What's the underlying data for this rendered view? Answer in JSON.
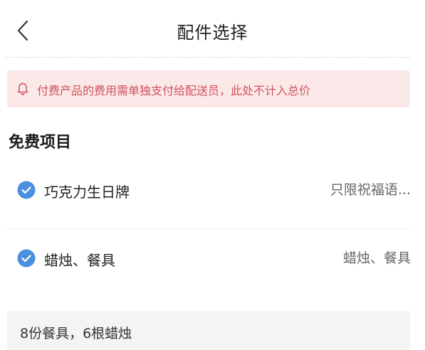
{
  "header": {
    "title": "配件选择",
    "back_icon": "chevron-left-icon"
  },
  "notice": {
    "icon": "bell-icon",
    "text": "付费产品的费用需单独支付给配送员，此处不计入总价",
    "color": "#d2505a",
    "background": "#fbe9ea"
  },
  "section": {
    "title": "免费项目"
  },
  "items": [
    {
      "label": "巧克力生日牌",
      "value": "只限祝福语...",
      "checked": true
    },
    {
      "label": "蜡烛、餐具",
      "value": "蜡烛、餐具",
      "checked": true
    }
  ],
  "note": {
    "text": "8份餐具，6根蜡烛"
  },
  "colors": {
    "check": "#4a8fe0",
    "notice_text": "#d2505a"
  }
}
